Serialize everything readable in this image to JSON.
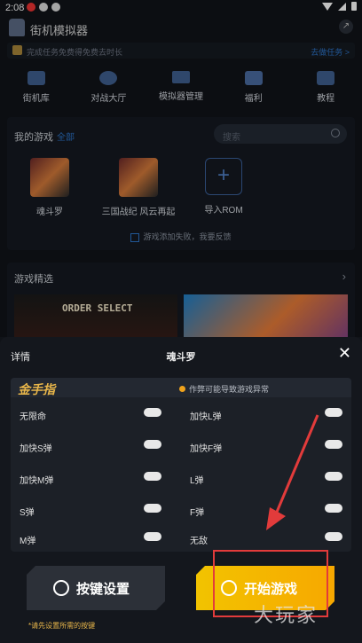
{
  "status_bar": {
    "time": "2:08"
  },
  "header": {
    "title": "街机模拟器"
  },
  "notice": {
    "text": "完成任务免费得免费去时长",
    "link": "去做任务 >"
  },
  "nav": [
    {
      "label": "街机库",
      "icon": "arcade-icon"
    },
    {
      "label": "对战大厅",
      "icon": "battle-icon"
    },
    {
      "label": "模拟器管理",
      "icon": "emulator-icon"
    },
    {
      "label": "福利",
      "icon": "gift-icon"
    },
    {
      "label": "教程",
      "icon": "book-icon"
    }
  ],
  "my_games": {
    "title": "我的游戏",
    "all_link": "全部",
    "search_placeholder": "搜索",
    "games": [
      {
        "name": "魂斗罗"
      },
      {
        "name": "三国战纪 风云再起"
      },
      {
        "name": "导入ROM"
      }
    ],
    "feedback": "游戏添加失败，我要反馈"
  },
  "featured": {
    "title": "游戏精选",
    "banner_text": "ORDER SELECT"
  },
  "modal": {
    "left_label": "详情",
    "title": "魂斗罗",
    "cheat_title": "金手指",
    "warning": "作弊可能导致游戏异常",
    "cheats": [
      {
        "label": "无限命",
        "enabled": false
      },
      {
        "label": "加快L弹",
        "enabled": false
      },
      {
        "label": "加快S弹",
        "enabled": false
      },
      {
        "label": "加快F弹",
        "enabled": false
      },
      {
        "label": "加快M弹",
        "enabled": false
      },
      {
        "label": "L弹",
        "enabled": false
      },
      {
        "label": "S弹",
        "enabled": false
      },
      {
        "label": "F弹",
        "enabled": false
      },
      {
        "label": "M弹",
        "enabled": false
      },
      {
        "label": "无敌",
        "enabled": false
      }
    ],
    "key_settings_label": "按键设置",
    "start_label": "开始游戏",
    "hint": "*请先设置所需的按键"
  },
  "watermark": "大玩家",
  "colors": {
    "accent": "#2d74c9",
    "gold": "#e8b64a",
    "start": "#f2c300",
    "highlight": "#e23b3b"
  }
}
